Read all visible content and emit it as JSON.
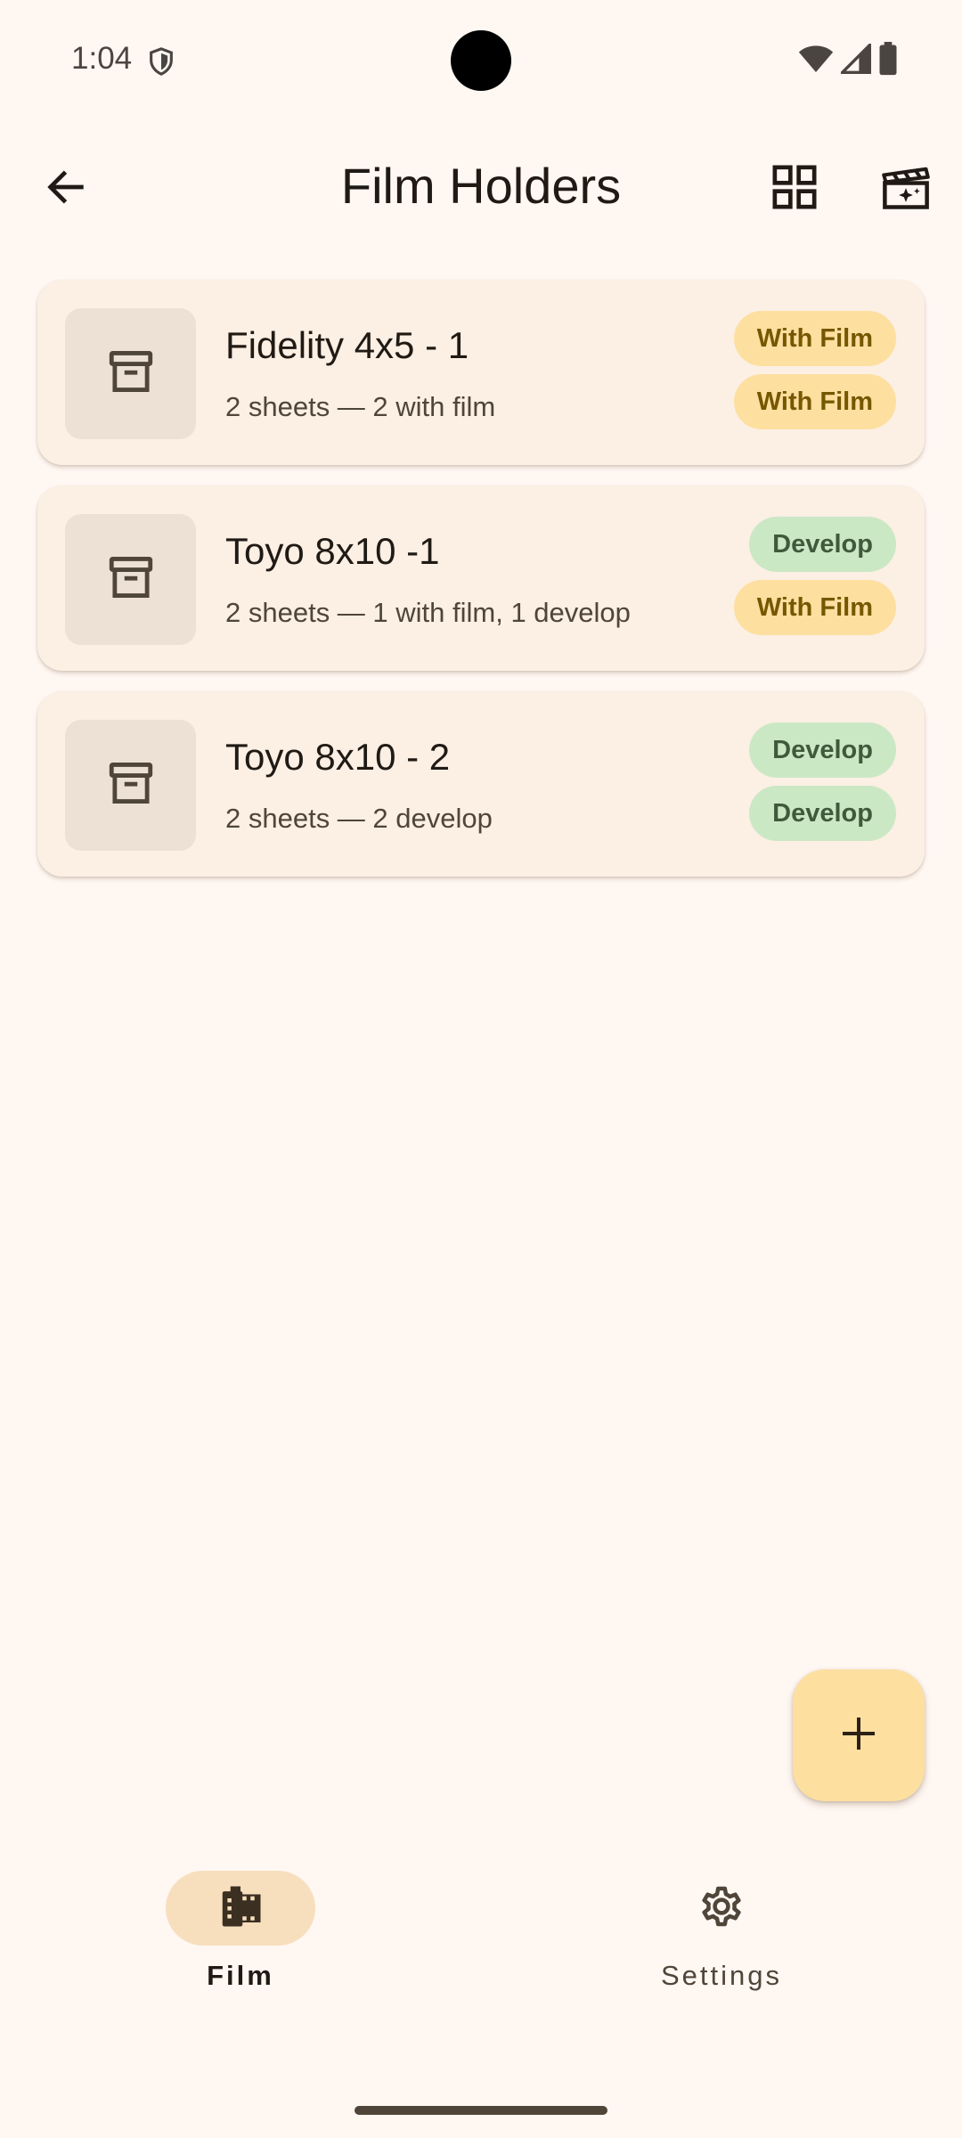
{
  "status_bar": {
    "time": "1:04",
    "icons": [
      "shield-icon",
      "wifi-icon",
      "signal-icon",
      "battery-icon"
    ]
  },
  "header": {
    "title": "Film Holders",
    "back_icon": "arrow-back-icon",
    "actions": [
      "grid-view-icon",
      "movie-film-icon"
    ]
  },
  "holders": [
    {
      "name": "Fidelity 4x5 - 1",
      "summary": "2 sheets — 2 with film",
      "chips": [
        {
          "label": "With Film",
          "kind": "with-film"
        },
        {
          "label": "With Film",
          "kind": "with-film"
        }
      ]
    },
    {
      "name": "Toyo 8x10 -1",
      "summary": "2 sheets — 1 with film, 1 develop",
      "chips": [
        {
          "label": "Develop",
          "kind": "develop"
        },
        {
          "label": "With Film",
          "kind": "with-film"
        }
      ]
    },
    {
      "name": "Toyo 8x10 - 2",
      "summary": "2 sheets — 2 develop",
      "chips": [
        {
          "label": "Develop",
          "kind": "develop"
        },
        {
          "label": "Develop",
          "kind": "develop"
        }
      ]
    }
  ],
  "fab": {
    "icon": "add-icon"
  },
  "bottom_nav": {
    "items": [
      {
        "label": "Film",
        "icon": "film-icon",
        "selected": true
      },
      {
        "label": "Settings",
        "icon": "gear-icon",
        "selected": false
      }
    ]
  },
  "colors": {
    "background": "#fff7f2",
    "card": "#fcefe4",
    "with_film_chip": "#fddfa0",
    "develop_chip": "#cbe8c5",
    "fab": "#fddfa0",
    "nav_indicator": "#f7dfbe"
  }
}
